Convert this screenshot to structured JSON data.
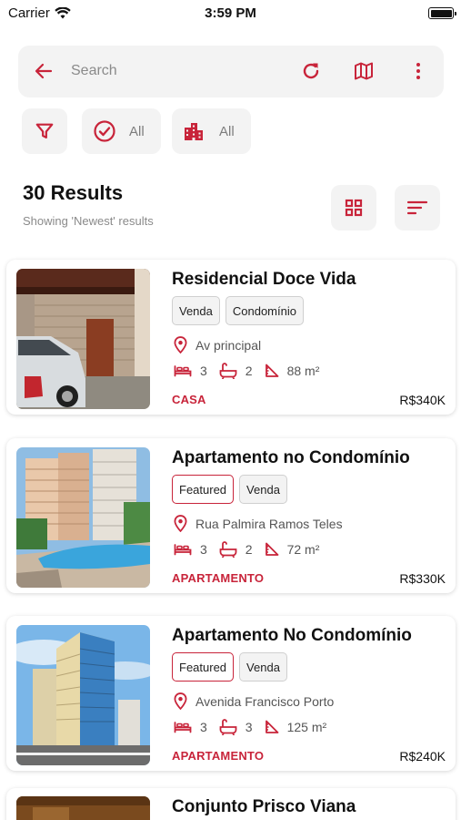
{
  "status_bar": {
    "carrier": "Carrier",
    "time": "3:59 PM"
  },
  "search": {
    "placeholder": "Search"
  },
  "filters": {
    "status_label": "All",
    "type_label": "All"
  },
  "results": {
    "title": "30 Results",
    "subtitle": "Showing 'Newest' results"
  },
  "colors": {
    "accent": "#c8243a",
    "chip_bg": "#f3f3f3"
  },
  "listings": [
    {
      "title": "Residencial Doce Vida",
      "tags": [
        "Venda",
        "Condomínio"
      ],
      "address": "Av principal",
      "bedrooms": "3",
      "bathrooms": "2",
      "area": "88 m²",
      "category": "CASA",
      "price": "R$340K"
    },
    {
      "title": "Apartamento no Condomínio",
      "tags": [
        "Featured",
        "Venda"
      ],
      "address": "Rua Palmira Ramos Teles",
      "bedrooms": "3",
      "bathrooms": "2",
      "area": "72 m²",
      "category": "APARTAMENTO",
      "price": "R$330K"
    },
    {
      "title": "Apartamento No Condomínio",
      "tags": [
        "Featured",
        "Venda"
      ],
      "address": "Avenida Francisco Porto",
      "bedrooms": "3",
      "bathrooms": "3",
      "area": "125 m²",
      "category": "APARTAMENTO",
      "price": "R$240K"
    },
    {
      "title": "Conjunto Prisco Viana"
    }
  ],
  "icons": {
    "back": "arrow-left-icon",
    "refresh": "refresh-icon",
    "map": "map-icon",
    "more": "more-vertical-icon",
    "filter": "filter-icon",
    "status": "check-circle-icon",
    "type": "building-icon",
    "grid": "grid-view-icon",
    "sort": "sort-icon",
    "location": "location-pin-icon",
    "bed": "bed-icon",
    "bath": "bathtub-icon",
    "area": "area-icon"
  }
}
